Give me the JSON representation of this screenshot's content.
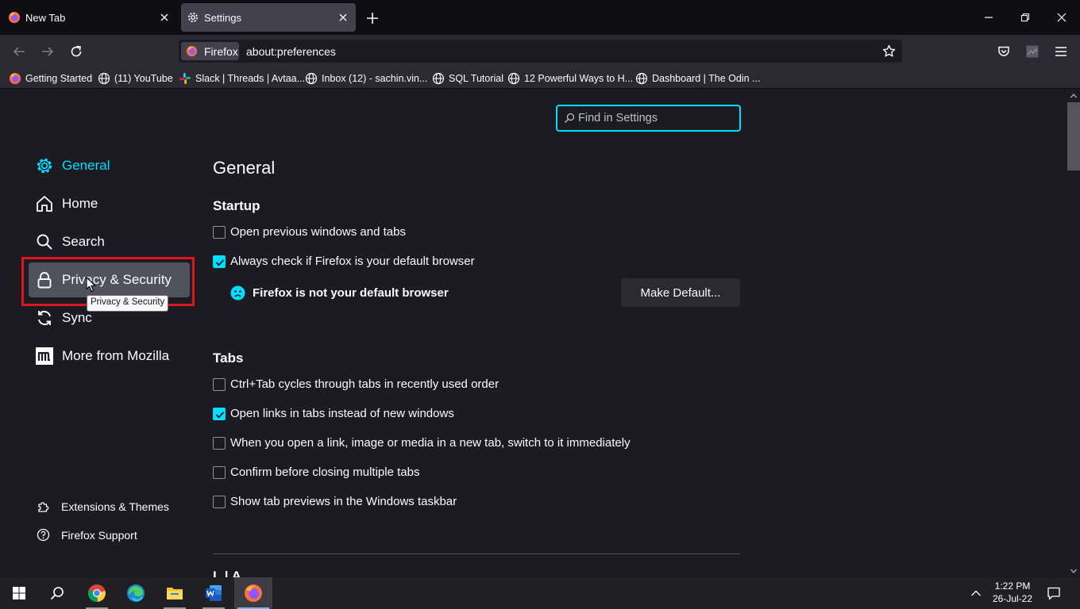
{
  "tabs": [
    {
      "label": "New Tab",
      "icon": "firefox-logo-icon",
      "active": false
    },
    {
      "label": "Settings",
      "icon": "gear-icon",
      "active": true
    }
  ],
  "urlbar": {
    "identity_label": "Firefox",
    "url": "about:preferences"
  },
  "bookmarks": [
    {
      "label": "Getting Started",
      "icon": "firefox-logo-icon"
    },
    {
      "label": "(11) YouTube",
      "icon": "globe-icon"
    },
    {
      "label": "Slack | Threads | Avtaa...",
      "icon": "slack-icon"
    },
    {
      "label": "Inbox (12) - sachin.vin...",
      "icon": "globe-icon"
    },
    {
      "label": "SQL Tutorial",
      "icon": "globe-icon"
    },
    {
      "label": "12 Powerful Ways to H...",
      "icon": "globe-icon"
    },
    {
      "label": "Dashboard | The Odin ...",
      "icon": "globe-icon"
    }
  ],
  "search": {
    "placeholder": "Find in Settings"
  },
  "sidebar": {
    "categories": [
      {
        "label": "General",
        "icon": "gear-icon",
        "active": true
      },
      {
        "label": "Home",
        "icon": "home-icon"
      },
      {
        "label": "Search",
        "icon": "search-icon"
      },
      {
        "label": "Privacy & Security",
        "icon": "lock-icon",
        "hovered": true
      },
      {
        "label": "Sync",
        "icon": "sync-icon"
      },
      {
        "label": "More from Mozilla",
        "icon": "mozilla-icon"
      }
    ],
    "tooltip": "Privacy & Security",
    "footer": [
      {
        "label": "Extensions & Themes",
        "icon": "puzzle-icon"
      },
      {
        "label": "Firefox Support",
        "icon": "help-icon"
      }
    ]
  },
  "main": {
    "title": "General",
    "startup": {
      "heading": "Startup",
      "options": [
        {
          "label": "Open previous windows and tabs",
          "checked": false
        },
        {
          "label": "Always check if Firefox is your default browser",
          "checked": true
        }
      ],
      "not_default_text": "Firefox is not your default browser",
      "make_default_label": "Make Default..."
    },
    "tabs_section": {
      "heading": "Tabs",
      "options": [
        {
          "label": "Ctrl+Tab cycles through tabs in recently used order",
          "checked": false
        },
        {
          "label": "Open links in tabs instead of new windows",
          "checked": true
        },
        {
          "label": "When you open a link, image or media in a new tab, switch to it immediately",
          "checked": false
        },
        {
          "label": "Confirm before closing multiple tabs",
          "checked": false
        },
        {
          "label": "Show tab previews in the Windows taskbar",
          "checked": false
        }
      ]
    },
    "next_heading_partial": "L                    |  A"
  },
  "taskbar": {
    "apps": [
      "windows-start-icon",
      "search-icon",
      "chrome-icon",
      "edge-icon",
      "file-explorer-icon",
      "word-icon",
      "firefox-logo-icon"
    ],
    "time": "1:22 PM",
    "date": "26-Jul-22"
  },
  "colors": {
    "accent": "#00ddff",
    "highlight_box": "#e0141e",
    "background": "#1c1b22",
    "toolbar": "#2b2a33"
  }
}
